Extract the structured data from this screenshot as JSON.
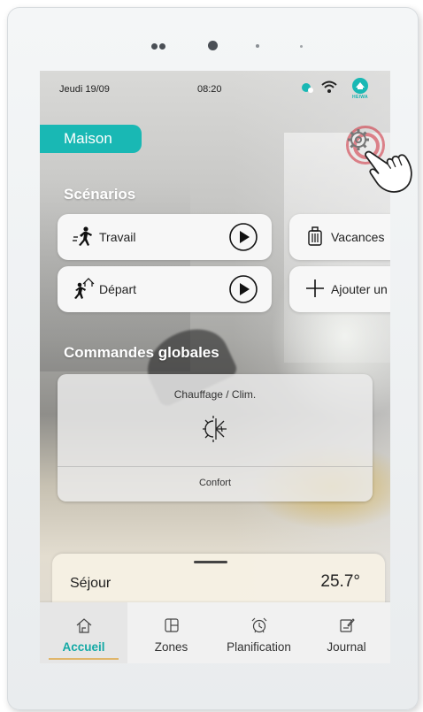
{
  "status_bar": {
    "date": "Jeudi 19/09",
    "time": "08:20",
    "brand": "HEIWA"
  },
  "header": {
    "home_label": "Maison"
  },
  "scenarios": {
    "title": "Scénarios",
    "items": [
      {
        "label": "Travail",
        "icon": "running-person-icon"
      },
      {
        "label": "Vacances",
        "icon": "suitcase-icon"
      },
      {
        "label": "Départ",
        "icon": "person-leaving-home-icon"
      },
      {
        "label": "Ajouter un",
        "icon": "plus-icon"
      }
    ]
  },
  "global_commands": {
    "title": "Commandes globales",
    "card": {
      "title": "Chauffage / Clim.",
      "mode": "Confort",
      "icon": "sun-snowflake-icon"
    }
  },
  "room": {
    "name": "Séjour",
    "temperature": "25.7°"
  },
  "nav": [
    {
      "label": "Accueil",
      "icon": "home-icon",
      "active": true
    },
    {
      "label": "Zones",
      "icon": "zones-icon",
      "active": false
    },
    {
      "label": "Planification",
      "icon": "alarm-clock-icon",
      "active": false
    },
    {
      "label": "Journal",
      "icon": "journal-edit-icon",
      "active": false
    }
  ],
  "colors": {
    "accent": "#19b8b4",
    "active_underline": "#e0b66b",
    "touch_ring": "#cd2837"
  }
}
